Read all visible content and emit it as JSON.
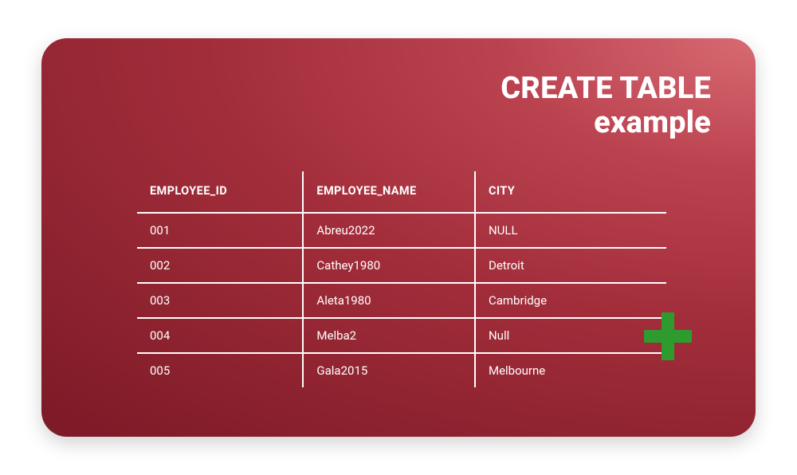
{
  "title": {
    "line1": "CREATE TABLE",
    "line2": "example"
  },
  "table": {
    "headers": [
      "EMPLOYEE_ID",
      "EMPLOYEE_NAME",
      "CITY"
    ],
    "rows": [
      {
        "employee_id": "001",
        "employee_name": "Abreu2022",
        "city": "NULL"
      },
      {
        "employee_id": "002",
        "employee_name": "Cathey1980",
        "city": "Detroit"
      },
      {
        "employee_id": "003",
        "employee_name": "Aleta1980",
        "city": "Cambridge"
      },
      {
        "employee_id": "004",
        "employee_name": "Melba2",
        "city": "Null"
      },
      {
        "employee_id": "005",
        "employee_name": "Gala2015",
        "city": "Melbourne"
      }
    ]
  },
  "colors": {
    "accent_green": "#2e9b2e"
  }
}
